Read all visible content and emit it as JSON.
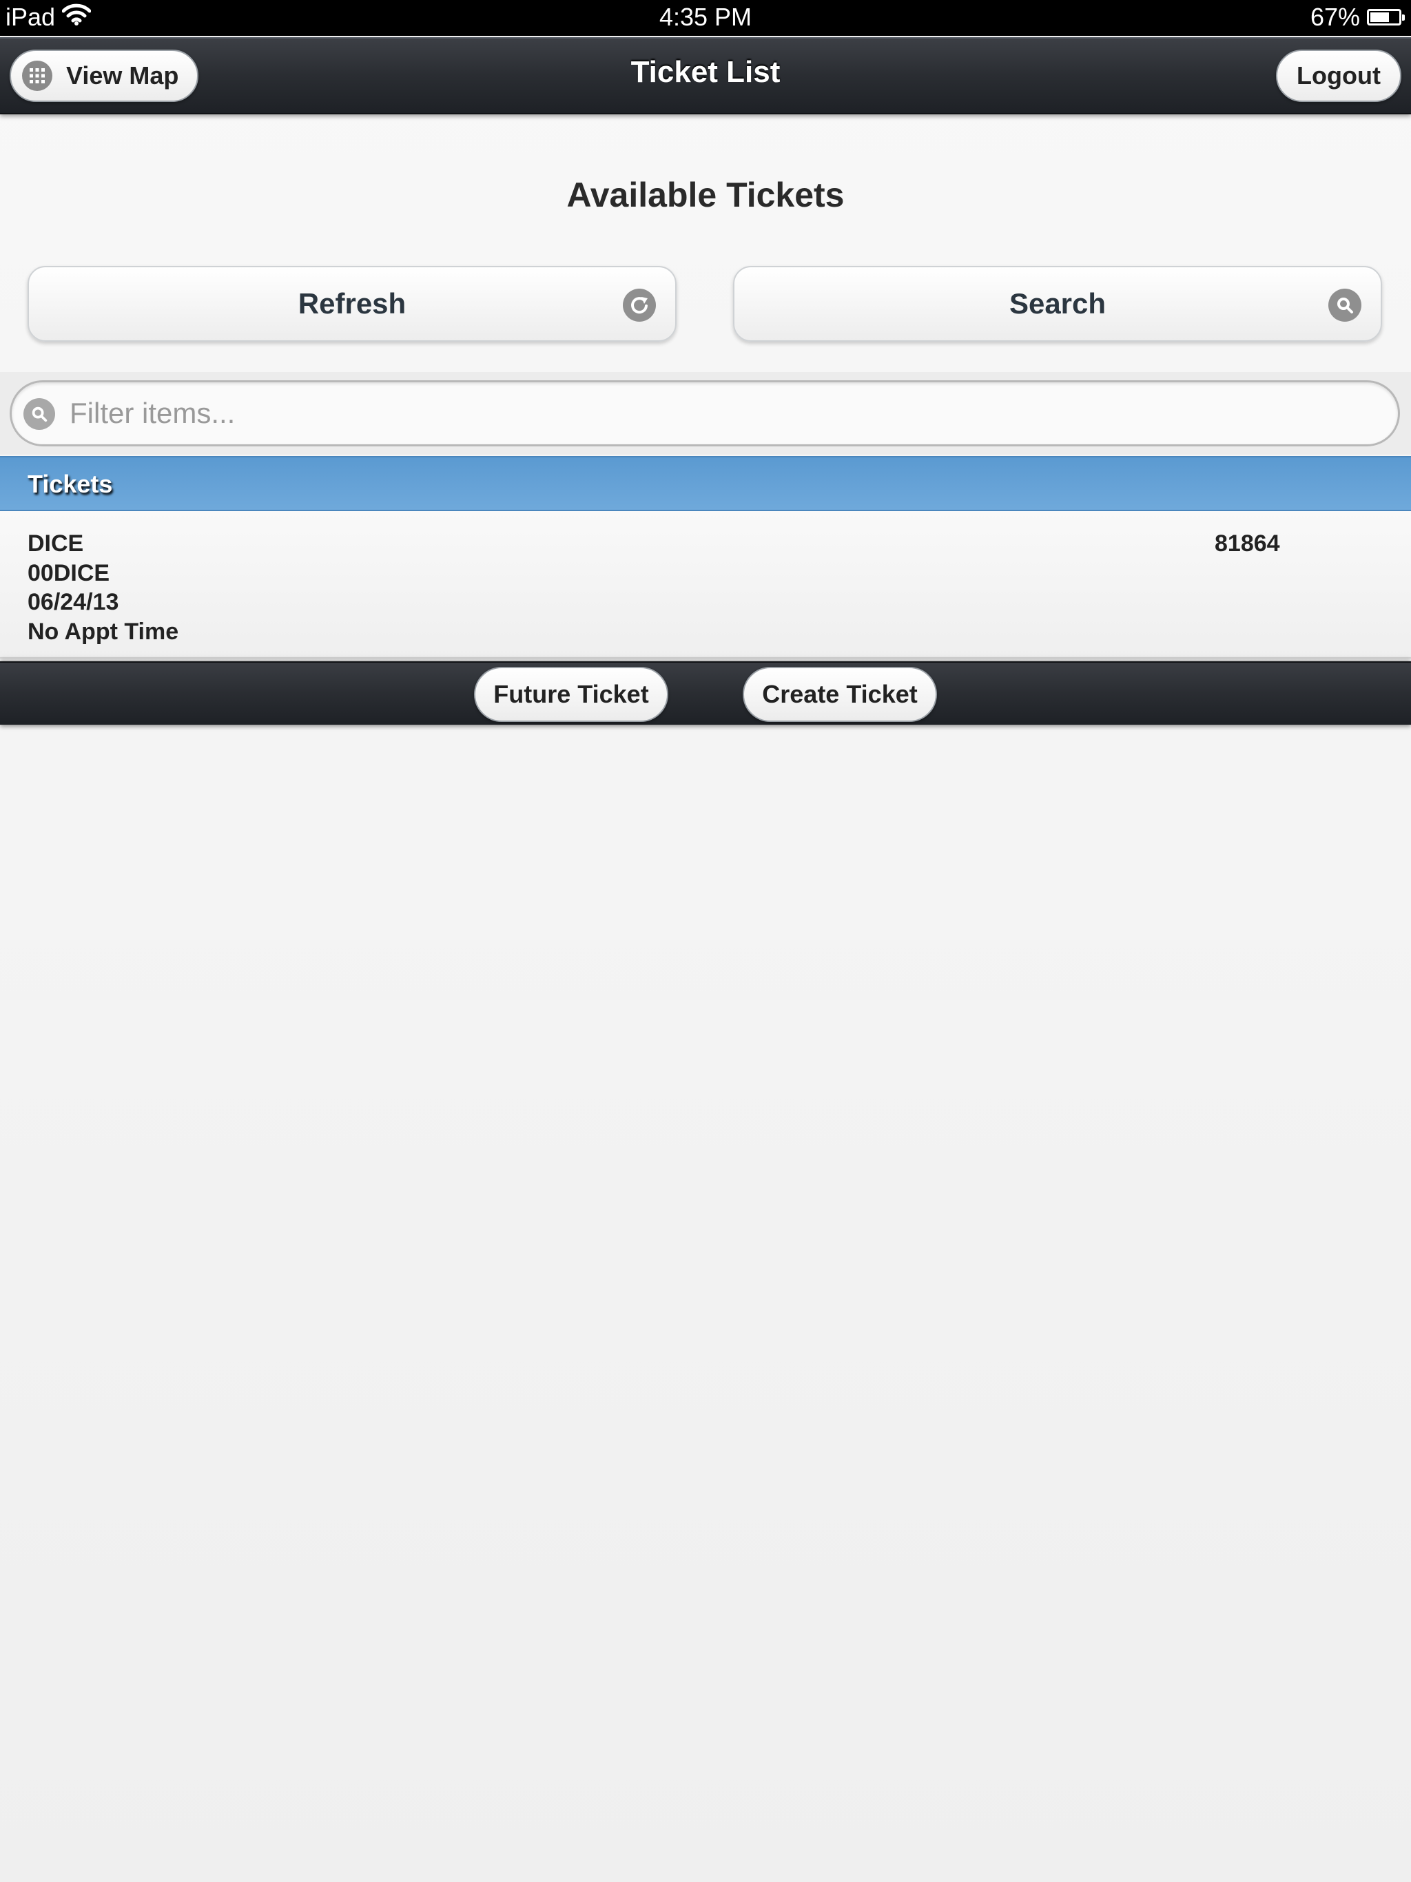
{
  "status_bar": {
    "device": "iPad",
    "time": "4:35 PM",
    "battery": "67%",
    "battery_level": 0.67,
    "icons": [
      "wifi-icon",
      "battery-charging-icon"
    ]
  },
  "header": {
    "title": "Ticket List",
    "view_map_label": "View Map",
    "logout_label": "Logout"
  },
  "main": {
    "heading": "Available Tickets",
    "refresh_label": "Refresh",
    "search_label": "Search"
  },
  "filter": {
    "placeholder": "Filter items...",
    "value": ""
  },
  "list": {
    "divider": "Tickets",
    "items": [
      {
        "name": "DICE",
        "code": "00DICE",
        "date": "06/24/13",
        "appt": "No Appt Time",
        "id": "81864"
      }
    ]
  },
  "footer": {
    "future_label": "Future Ticket",
    "create_label": "Create Ticket"
  },
  "colors": {
    "header_bar": "#2a2d32",
    "divider_blue": "#5b9ad1",
    "page_background": "#f3f3f3"
  }
}
